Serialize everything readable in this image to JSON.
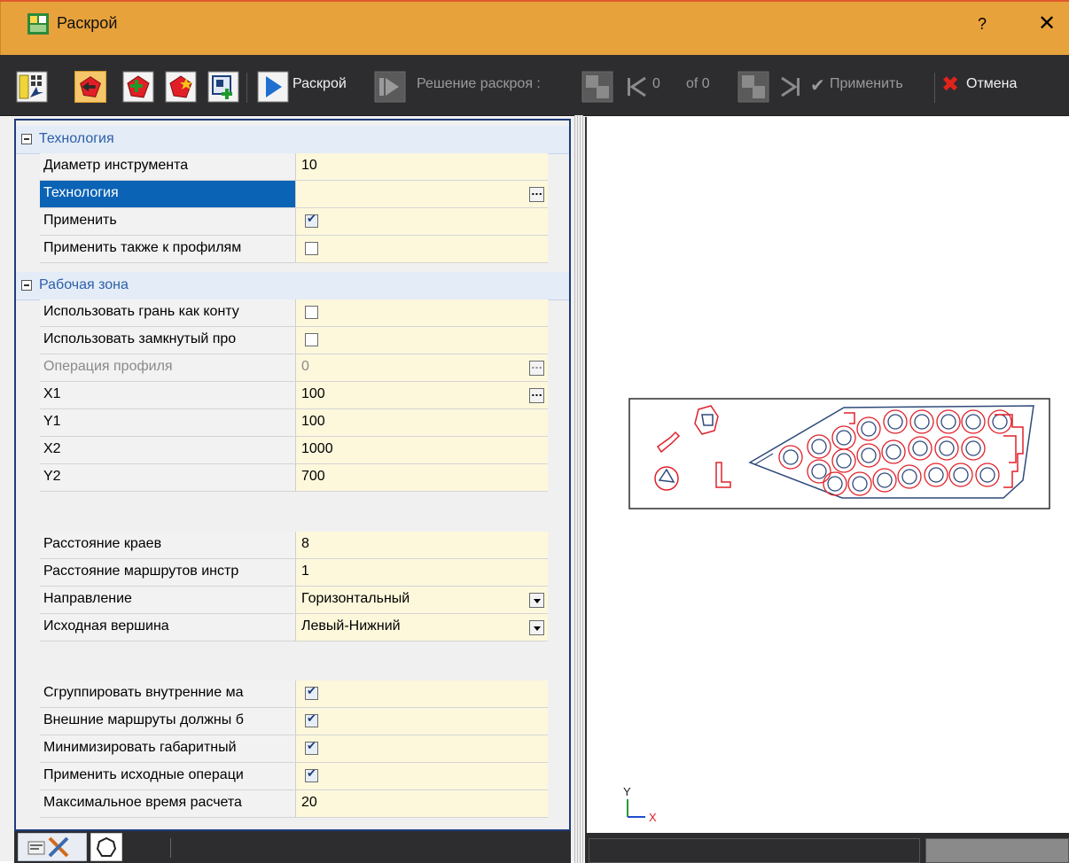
{
  "window": {
    "title": "Раскрой",
    "help_label": "?",
    "close_label": "✕"
  },
  "toolbar": {
    "run_label": "Раскрой",
    "solution_label": "Решение раскроя :",
    "counter_current": "0",
    "counter_total": "of 0",
    "apply_label": "Применить",
    "cancel_label": "Отмена"
  },
  "properties": {
    "groups": [
      {
        "name": "Технология"
      },
      {
        "name": "Рабочая зона"
      }
    ],
    "rows": [
      {
        "label": "Диаметр инструмента",
        "value": "10"
      },
      {
        "label": "Технология",
        "value": ""
      },
      {
        "label": "Применить",
        "checked": true
      },
      {
        "label": "Применить также к профилям",
        "checked": false
      },
      {
        "label": "Использовать грань как конту",
        "checked": false
      },
      {
        "label": "Использовать замкнутый про",
        "checked": false
      },
      {
        "label": "Операция профиля",
        "value": "0"
      },
      {
        "label": "X1",
        "value": "100"
      },
      {
        "label": "Y1",
        "value": "100"
      },
      {
        "label": "X2",
        "value": "1000"
      },
      {
        "label": "Y2",
        "value": "700"
      },
      {
        "label": "Расстояние краев",
        "value": "8"
      },
      {
        "label": "Расстояние маршрутов инстр",
        "value": "1"
      },
      {
        "label": "Направление",
        "value": "Горизонтальный"
      },
      {
        "label": "Исходная вершина",
        "value": "Левый-Нижний"
      },
      {
        "label": "Сгруппировать внутренние ма",
        "checked": true
      },
      {
        "label": "Внешние маршруты должны б",
        "checked": true
      },
      {
        "label": "Минимизировать габаритный",
        "checked": true
      },
      {
        "label": "Применить исходные операци",
        "checked": true
      },
      {
        "label": "Максимальное время расчета",
        "value": "20"
      }
    ]
  },
  "canvas": {
    "axis_y": "Y",
    "axis_x": "X"
  },
  "colors": {
    "title_bar": "#e8a23c",
    "selection": "#0a63b5",
    "value_bg": "#fdf8dc",
    "part_outline": "#2e4a7a",
    "tool_path": "#e0202a"
  }
}
